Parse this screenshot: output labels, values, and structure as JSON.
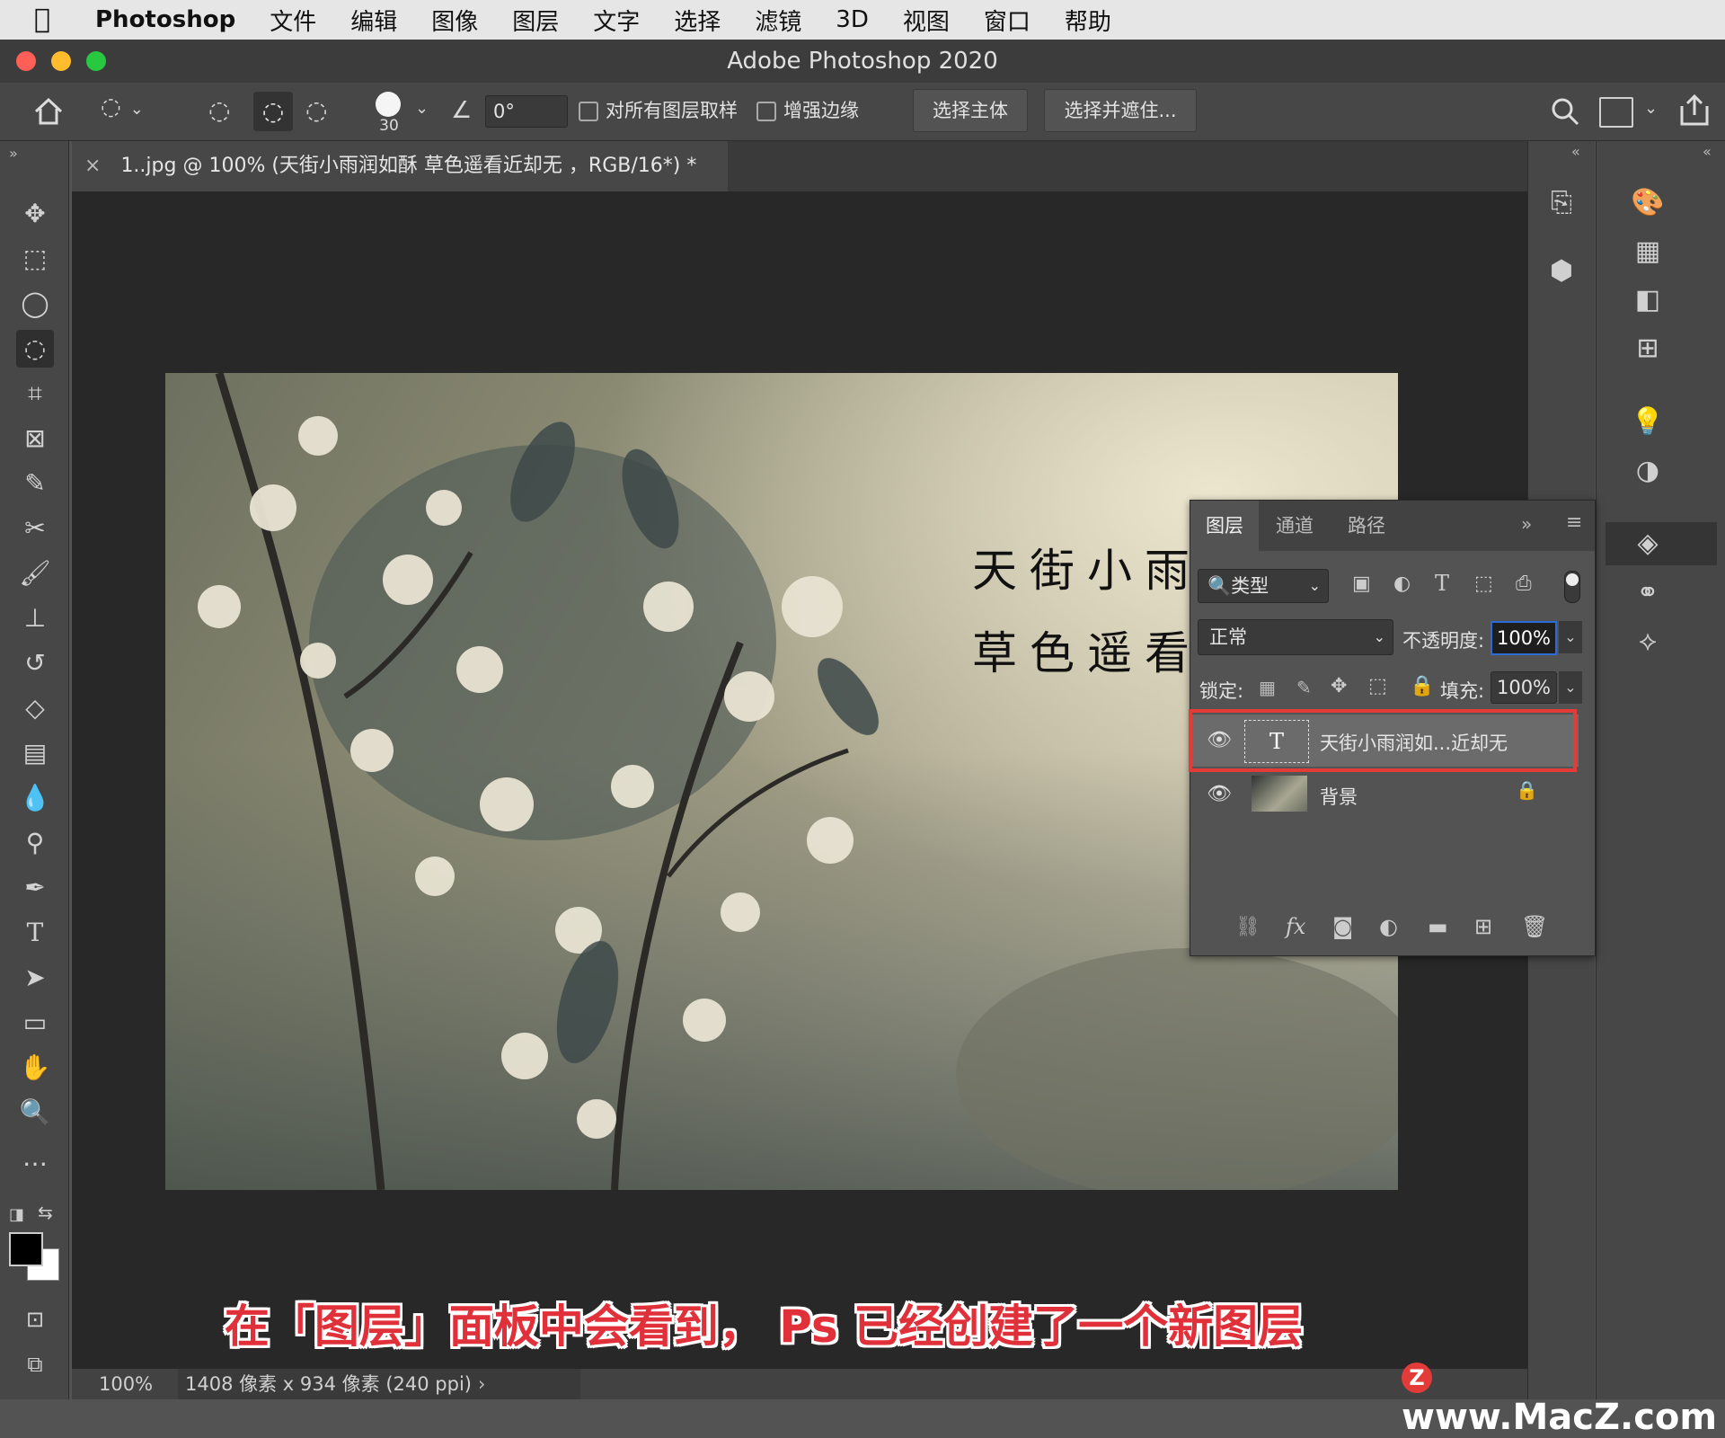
{
  "menubar": {
    "app_name": "Photoshop",
    "items": [
      "文件",
      "编辑",
      "图像",
      "图层",
      "文字",
      "选择",
      "滤镜",
      "3D",
      "视图",
      "窗口",
      "帮助"
    ]
  },
  "window": {
    "title": "Adobe Photoshop 2020"
  },
  "options_bar": {
    "brush_size": "30",
    "angle": "0°",
    "sample_all_layers": "对所有图层取样",
    "enhance_edge": "增强边缘",
    "select_subject": "选择主体",
    "select_and_mask": "选择并遮住..."
  },
  "document_tab": {
    "close": "×",
    "title": "1..jpg @ 100% (天街小雨润如酥 草色遥看近却无 ，RGB/16*) *"
  },
  "canvas_text": {
    "line1": "天街小雨",
    "line2": "草色遥看"
  },
  "layers_panel": {
    "tabs": [
      "图层",
      "通道",
      "路径"
    ],
    "filter_kind": "类型",
    "blend_mode": "正常",
    "opacity_label": "不透明度:",
    "opacity_value": "100%",
    "lock_label": "锁定:",
    "fill_label": "填充:",
    "fill_value": "100%",
    "layers": [
      {
        "name": "天街小雨润如...近却无",
        "thumb": "T",
        "selected": true
      },
      {
        "name": "背景",
        "locked": true
      }
    ],
    "footer_icons": [
      "link-icon",
      "fx-icon",
      "mask-icon",
      "adjustment-icon",
      "folder-icon",
      "new-layer-icon",
      "trash-icon"
    ],
    "fx_label": "fx"
  },
  "status_bar": {
    "zoom": "100%",
    "doc_info": "1408 像素 x 934 像素 (240 ppi)"
  },
  "caption": "在「图层」面板中会看到， Ps 已经创建了一个新图层",
  "watermark": "www.MacZ.com",
  "colors": {
    "highlight": "#e23b38",
    "caption": "#e0303a",
    "accent": "#2d6bd6"
  }
}
